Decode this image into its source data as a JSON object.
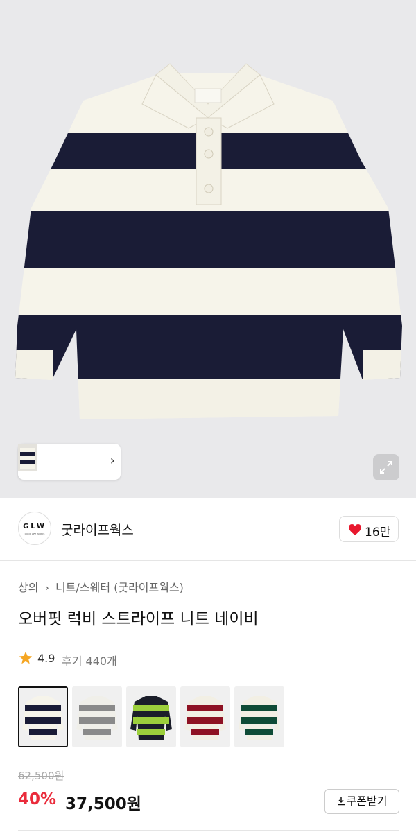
{
  "colors": {
    "navy": "#1a1c36",
    "cream": "#f6f4ea",
    "accent_red": "#ea2b3b",
    "heart": "#e8182e",
    "star": "#f5a623",
    "swatches": [
      {
        "stripe": "#1a1c36",
        "base": "#f6f4ea"
      },
      {
        "stripe": "#8a8a8a",
        "base": "#f0efe9"
      },
      {
        "stripe": "#9ccf3c",
        "base": "#1b1e2a"
      },
      {
        "stripe": "#8e1223",
        "base": "#f2efe4"
      },
      {
        "stripe": "#0f4b36",
        "base": "#f2efe4"
      }
    ]
  },
  "gallery": {
    "chevron": "›",
    "expand_icon": "expand-icon"
  },
  "brand": {
    "logo_text": "GLW",
    "logo_sub": "GOOD LIFE WORKS",
    "name": "굿라이프웍스",
    "likes": "16만"
  },
  "breadcrumb": {
    "items": [
      "상의",
      "니트/스웨터 (굿라이프웍스)"
    ],
    "separator": "›"
  },
  "product": {
    "title": "오버핏 럭비 스트라이프 니트 네이비",
    "rating": "4.9",
    "reviews": "후기 440개",
    "original_price": "62,500원",
    "discount": "40%",
    "price": "37,500원",
    "coupon_label": "쿠폰받기",
    "coupon_icon": "download-icon"
  }
}
